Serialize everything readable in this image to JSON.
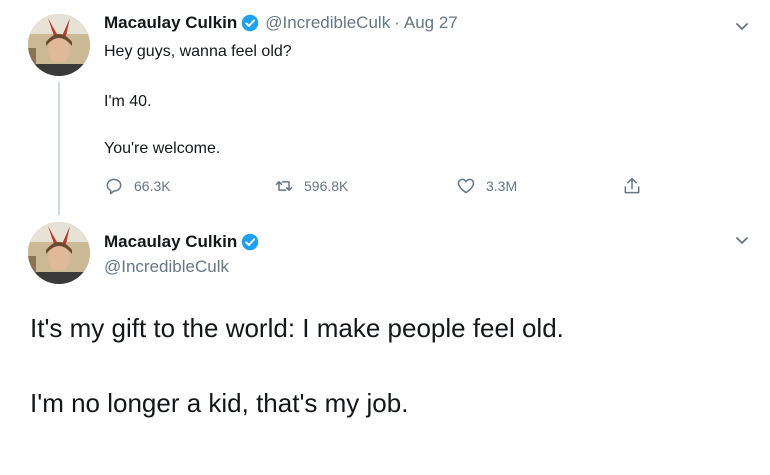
{
  "tweet1": {
    "author_name": "Macaulay Culkin",
    "handle": "@IncredibleCulk",
    "separator": "·",
    "date": "Aug 27",
    "lines": [
      "Hey guys, wanna feel old?",
      "I'm 40.",
      "You're welcome."
    ],
    "actions": {
      "reply_count": "66.3K",
      "retweet_count": "596.8K",
      "like_count": "3.3M"
    }
  },
  "tweet2": {
    "author_name": "Macaulay Culkin",
    "handle": "@IncredibleCulk",
    "lines": [
      "It's my gift to the world: I make people feel old.",
      "I'm no longer a kid, that's my job."
    ]
  },
  "colors": {
    "verified_badge": "#1da1f2",
    "secondary_text": "#657786",
    "thread_line": "#cfd9de"
  },
  "icons": [
    "reply-icon",
    "retweet-icon",
    "like-icon",
    "share-icon",
    "chevron-down-icon",
    "verified-badge-icon"
  ]
}
